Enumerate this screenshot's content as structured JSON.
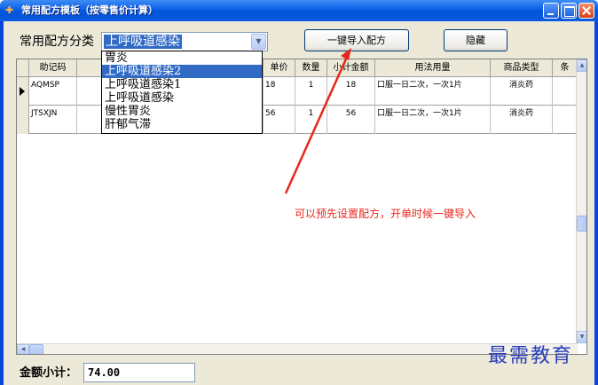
{
  "window": {
    "title": "常用配方模板（按零售价计算）",
    "accent": "#0a46d6"
  },
  "toolbar": {
    "category_label": "常用配方分类",
    "category_value": "上呼吸道感染",
    "import_button": "一键导入配方",
    "hide_button": "隐藏"
  },
  "dropdown": {
    "options": [
      "胃炎",
      "上呼吸道感染2",
      "上呼吸道感染1",
      "上呼吸道感染",
      "慢性胃炎",
      "肝郁气滞"
    ],
    "selected_index": 1
  },
  "grid": {
    "columns": [
      "助记码",
      "单价",
      "数量",
      "小计金额",
      "用法用量",
      "商品类型",
      "条"
    ],
    "rows": [
      {
        "code": "AQMSP",
        "price": "18",
        "qty": "1",
        "subtotal": "18",
        "usage": "口服一日二次，一次1片",
        "type": "消炎药"
      },
      {
        "code": "JTSXJN",
        "price": "56",
        "qty": "1",
        "subtotal": "56",
        "usage": "口服一日二次，一次1片",
        "type": "消炎药"
      }
    ]
  },
  "annotation": {
    "text": "可以预先设置配方，开单时候一键导入",
    "color": "#e8261c"
  },
  "footer": {
    "total_label": "金额小计：",
    "total_value": "74.00"
  },
  "watermark": {
    "text": "最需教育"
  }
}
